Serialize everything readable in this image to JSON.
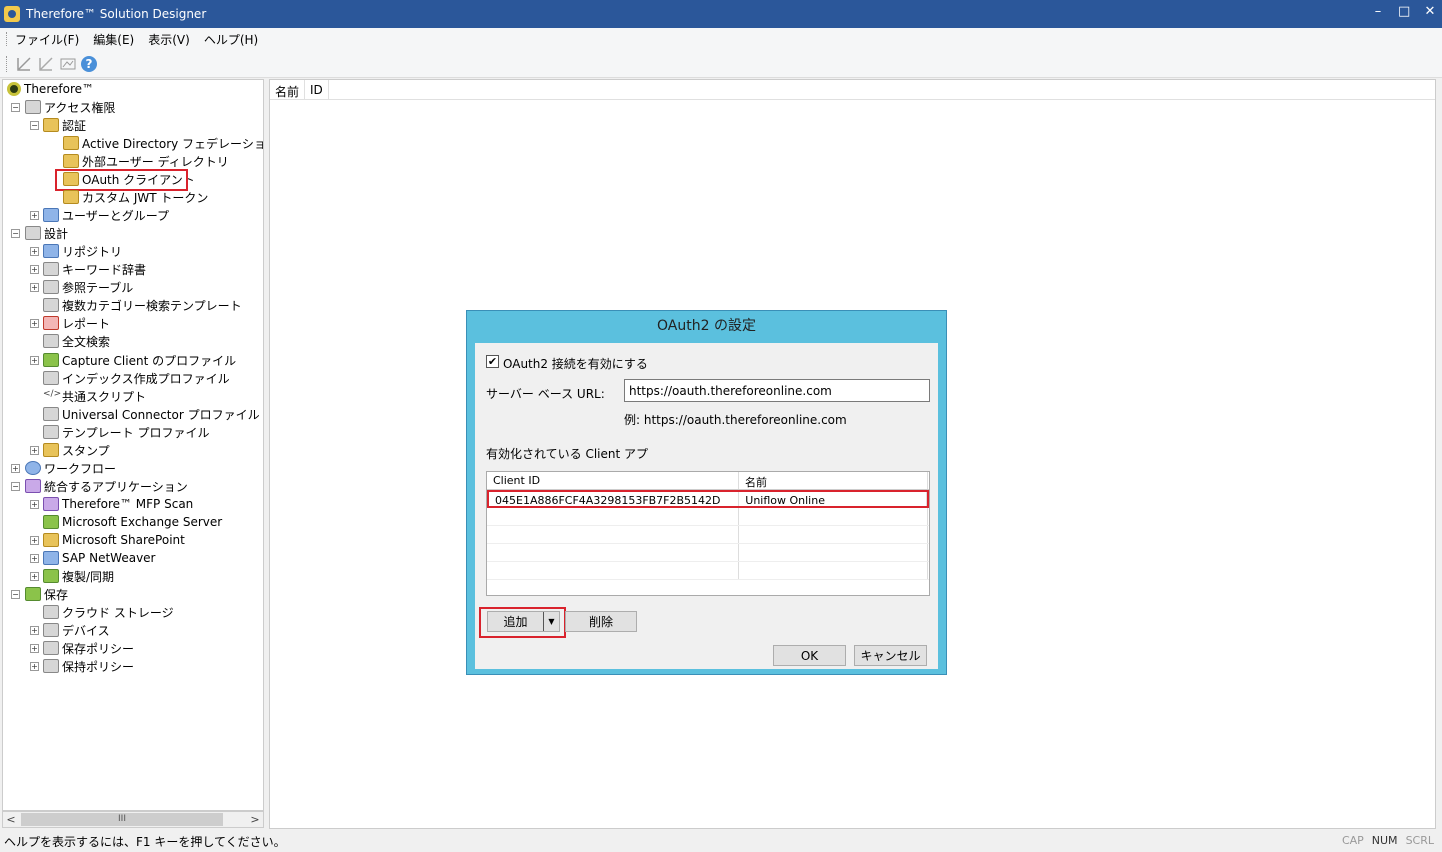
{
  "window": {
    "title": "Therefore™ Solution Designer",
    "minimize": "–",
    "maximize": "□",
    "close": "✕"
  },
  "menu": [
    "ファイル(F)",
    "編集(E)",
    "表示(V)",
    "ヘルプ(H)"
  ],
  "toolbar": {
    "help_label": "?"
  },
  "tree": {
    "root": "Therefore™",
    "items": [
      {
        "label": "アクセス権限"
      },
      {
        "label": "認証"
      },
      {
        "label": "Active Directory フェデレーション サ"
      },
      {
        "label": "外部ユーザー ディレクトリ"
      },
      {
        "label": "OAuth クライアント"
      },
      {
        "label": "カスタム JWT トークン"
      },
      {
        "label": "ユーザーとグループ"
      },
      {
        "label": "設計"
      },
      {
        "label": "リポジトリ"
      },
      {
        "label": "キーワード辞書"
      },
      {
        "label": "参照テーブル"
      },
      {
        "label": "複数カテゴリー検索テンプレート"
      },
      {
        "label": "レポート"
      },
      {
        "label": "全文検索"
      },
      {
        "label": "Capture Client のプロファイル"
      },
      {
        "label": "インデックス作成プロファイル"
      },
      {
        "label": "共通スクリプト"
      },
      {
        "label": "Universal Connector プロファイル"
      },
      {
        "label": "テンプレート プロファイル"
      },
      {
        "label": "スタンプ"
      },
      {
        "label": "ワークフロー"
      },
      {
        "label": "統合するアプリケーション"
      },
      {
        "label": "Therefore™ MFP Scan"
      },
      {
        "label": "Microsoft Exchange Server"
      },
      {
        "label": "Microsoft SharePoint"
      },
      {
        "label": "SAP NetWeaver"
      },
      {
        "label": "複製/同期"
      },
      {
        "label": "保存"
      },
      {
        "label": "クラウド ストレージ"
      },
      {
        "label": "デバイス"
      },
      {
        "label": "保存ポリシー"
      },
      {
        "label": "保持ポリシー"
      }
    ],
    "scroll_thumb": "III"
  },
  "list": {
    "columns": [
      "名前",
      "ID"
    ]
  },
  "dialog": {
    "title": "OAuth2 の設定",
    "enable_label": "OAuth2 接続を有効にする",
    "enable_checked": "✔",
    "server_url_label": "サーバー ベース URL:",
    "server_url_value": "https://oauth.thereforeonline.com",
    "example": "例: https://oauth.thereforeonline.com",
    "apps_label": "有効化されている Client アプ",
    "grid_headers": [
      "Client ID",
      "名前"
    ],
    "grid_rows": [
      {
        "client_id": "045E1A886FCF4A3298153FB7F2B5142D",
        "name": "Uniflow Online"
      }
    ],
    "add_label": "追加",
    "delete_label": "削除",
    "ok_label": "OK",
    "cancel_label": "キャンセル"
  },
  "status": {
    "help_text": "ヘルプを表示するには、F1 キーを押してください。",
    "cap": "CAP",
    "num": "NUM",
    "scrl": "SCRL"
  }
}
